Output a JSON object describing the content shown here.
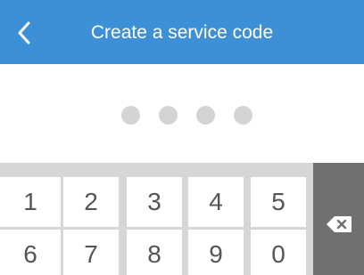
{
  "header": {
    "title": "Create a service code",
    "back_icon": "chevron-left-icon"
  },
  "pin": {
    "length": 4,
    "filled": 0
  },
  "keypad": {
    "keys": [
      "1",
      "2",
      "3",
      "4",
      "5",
      "6",
      "7",
      "8",
      "9",
      "0"
    ],
    "backspace_icon": "backspace-icon"
  },
  "colors": {
    "header_bg": "#3d8fd6",
    "header_text": "#ffffff",
    "dot": "#d4d4d4",
    "keypad_bg": "#d6d6d6",
    "key_bg": "#ffffff",
    "key_text": "#555555",
    "backspace_bg": "#707070"
  }
}
